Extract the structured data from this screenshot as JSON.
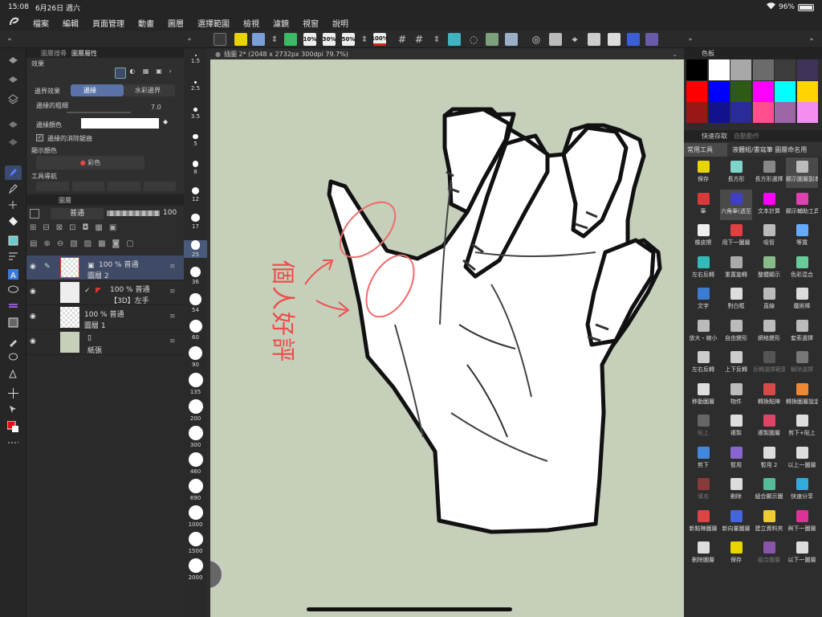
{
  "status": {
    "time": "15:08",
    "date": "6月26日 週六",
    "battery": "96%"
  },
  "menu": [
    "檔案",
    "編輯",
    "頁面管理",
    "動畫",
    "圖層",
    "選擇範圍",
    "檢視",
    "濾鏡",
    "視窗",
    "說明"
  ],
  "toolbar": {
    "zoom_buttons": [
      "10%",
      "30%",
      "50%",
      "100%"
    ]
  },
  "props": {
    "tabs": [
      "圖層搜尋",
      "圖層屬性"
    ],
    "section_effect": "效果",
    "border_effect_label": "邊界效果",
    "border_option": "邊緣",
    "watercolor_option": "水彩邊界",
    "thickness_label": "邊緣的粗細",
    "thickness_value": "7.0",
    "color_label": "邊緣顏色",
    "antialias_label": "邊緣的消除鋸齒",
    "display_color_section": "顯示顏色",
    "display_color_value": "彩色",
    "tool_nav_section": "工具導航"
  },
  "layers": {
    "tab": "圖層",
    "blend_mode": "普通",
    "opacity": "100",
    "items": [
      {
        "line1": "100 % 普通",
        "line2": "圖層 2"
      },
      {
        "line1": "100 % 普通",
        "line2": "【3D】左手"
      },
      {
        "line1": "100 % 普通",
        "line2": "圖層 1"
      },
      {
        "line1": "",
        "line2": "紙張"
      }
    ]
  },
  "brush_sizes": [
    "1.5",
    "2.5",
    "3.5",
    "5",
    "8",
    "12",
    "17",
    "25",
    "36",
    "54",
    "60",
    "90",
    "135",
    "200",
    "300",
    "460",
    "690",
    "1000",
    "1500",
    "2000"
  ],
  "document": {
    "title": "插圖 2* (2048 x 2732px 300dpi 79.7%)"
  },
  "canvas": {
    "annotation": "個人好評"
  },
  "palette": {
    "title": "色板",
    "colors": [
      "#000000",
      "#ffffff",
      "#a8a8a8",
      "#6b6b6b",
      "#3c3c3c",
      "#3f3358",
      "#ff0000",
      "#0000ff",
      "#2d5a14",
      "#ff00ff",
      "#00ffff",
      "#ffd400",
      "#9a1717",
      "#12128e",
      "#2a2a9a",
      "#ff4f8e",
      "#9b65a6",
      "#f28ef0"
    ]
  },
  "quick_access": {
    "tabs": [
      "快速存取",
      "自動動作"
    ],
    "header_left": "常用工具",
    "header_right": "液體組/書寫筆 圖層命名用",
    "items": [
      {
        "label": "保存",
        "color": "#e8d400",
        "disabled": false
      },
      {
        "label": "長方形",
        "color": "#7fd4c9",
        "disabled": false
      },
      {
        "label": "長方形選擇",
        "color": "#888888",
        "disabled": false
      },
      {
        "label": "顯示圖層副本",
        "color": "#bbbbbb",
        "disabled": false
      },
      {
        "label": "筆",
        "color": "#d83a3a",
        "disabled": false
      },
      {
        "label": "六角筆(透至",
        "color": "#4040c0",
        "disabled": false
      },
      {
        "label": "文本計算",
        "color": "#ff00ff",
        "disabled": false
      },
      {
        "label": "顯示輔助工具",
        "color": "#e23fb0",
        "disabled": false
      },
      {
        "label": "橡皮擦",
        "color": "#eeeeee",
        "disabled": false
      },
      {
        "label": "用下一圖層",
        "color": "#e04040",
        "disabled": false
      },
      {
        "label": "吸管",
        "color": "#bbbbbb",
        "disabled": false
      },
      {
        "label": "等寬",
        "color": "#66aaff",
        "disabled": false
      },
      {
        "label": "左右反轉",
        "color": "#33bbbb",
        "disabled": false
      },
      {
        "label": "重置旋轉",
        "color": "#aaaaaa",
        "disabled": false
      },
      {
        "label": "整體顯示",
        "color": "#88bb88",
        "disabled": false
      },
      {
        "label": "色彩混合",
        "color": "#66cc99",
        "disabled": false
      },
      {
        "label": "文字",
        "color": "#3b7bd4",
        "disabled": false
      },
      {
        "label": "對白框",
        "color": "#dddddd",
        "disabled": false
      },
      {
        "label": "直線",
        "color": "#bbbbbb",
        "disabled": false
      },
      {
        "label": "魔術棒",
        "color": "#dddddd",
        "disabled": false
      },
      {
        "label": "放大・縮小",
        "color": "#bbbbbb",
        "disabled": false
      },
      {
        "label": "自由變形",
        "color": "#bbbbbb",
        "disabled": false
      },
      {
        "label": "網格變形",
        "color": "#bbbbbb",
        "disabled": false
      },
      {
        "label": "套索選擇",
        "color": "#bbbbbb",
        "disabled": false
      },
      {
        "label": "左右反轉",
        "color": "#cccccc",
        "disabled": false
      },
      {
        "label": "上下反轉",
        "color": "#cccccc",
        "disabled": false
      },
      {
        "label": "反轉選擇範圍",
        "color": "#555555",
        "disabled": true
      },
      {
        "label": "解除選擇",
        "color": "#777777",
        "disabled": true
      },
      {
        "label": "移動圖層",
        "color": "#dddddd",
        "disabled": false
      },
      {
        "label": "物件",
        "color": "#bbbbbb",
        "disabled": false
      },
      {
        "label": "轉換點陣",
        "color": "#d84a4a",
        "disabled": false
      },
      {
        "label": "轉換圖層設定",
        "color": "#ee8833",
        "disabled": false
      },
      {
        "label": "貼上",
        "color": "#666666",
        "disabled": true
      },
      {
        "label": "複製",
        "color": "#dddddd",
        "disabled": false
      },
      {
        "label": "複製圖層",
        "color": "#dd4466",
        "disabled": false
      },
      {
        "label": "剪下+貼上",
        "color": "#dddddd",
        "disabled": false
      },
      {
        "label": "剪下",
        "color": "#4488dd",
        "disabled": false
      },
      {
        "label": "暫用",
        "color": "#8866cc",
        "disabled": false
      },
      {
        "label": "暫用 2",
        "color": "#dddddd",
        "disabled": false
      },
      {
        "label": "以上一圖層",
        "color": "#dddddd",
        "disabled": false
      },
      {
        "label": "填充",
        "color": "#8a3a3a",
        "disabled": true
      },
      {
        "label": "刪除",
        "color": "#dddddd",
        "disabled": false
      },
      {
        "label": "組合顯示圖",
        "color": "#55bb99",
        "disabled": false
      },
      {
        "label": "快速分享",
        "color": "#33aadd",
        "disabled": false
      },
      {
        "label": "新點陣圖層",
        "color": "#dd4444",
        "disabled": false
      },
      {
        "label": "新向量圖層",
        "color": "#4466dd",
        "disabled": false
      },
      {
        "label": "建立資料夾",
        "color": "#eecc33",
        "disabled": false
      },
      {
        "label": "與下一圖層",
        "color": "#dd3399",
        "disabled": false
      },
      {
        "label": "刪除圖層",
        "color": "#dddddd",
        "disabled": false
      },
      {
        "label": "保存",
        "color": "#e8d400",
        "disabled": false
      },
      {
        "label": "組合圖層",
        "color": "#8855aa",
        "disabled": true
      },
      {
        "label": "以下一圖層",
        "color": "#dddddd",
        "disabled": false
      }
    ]
  }
}
